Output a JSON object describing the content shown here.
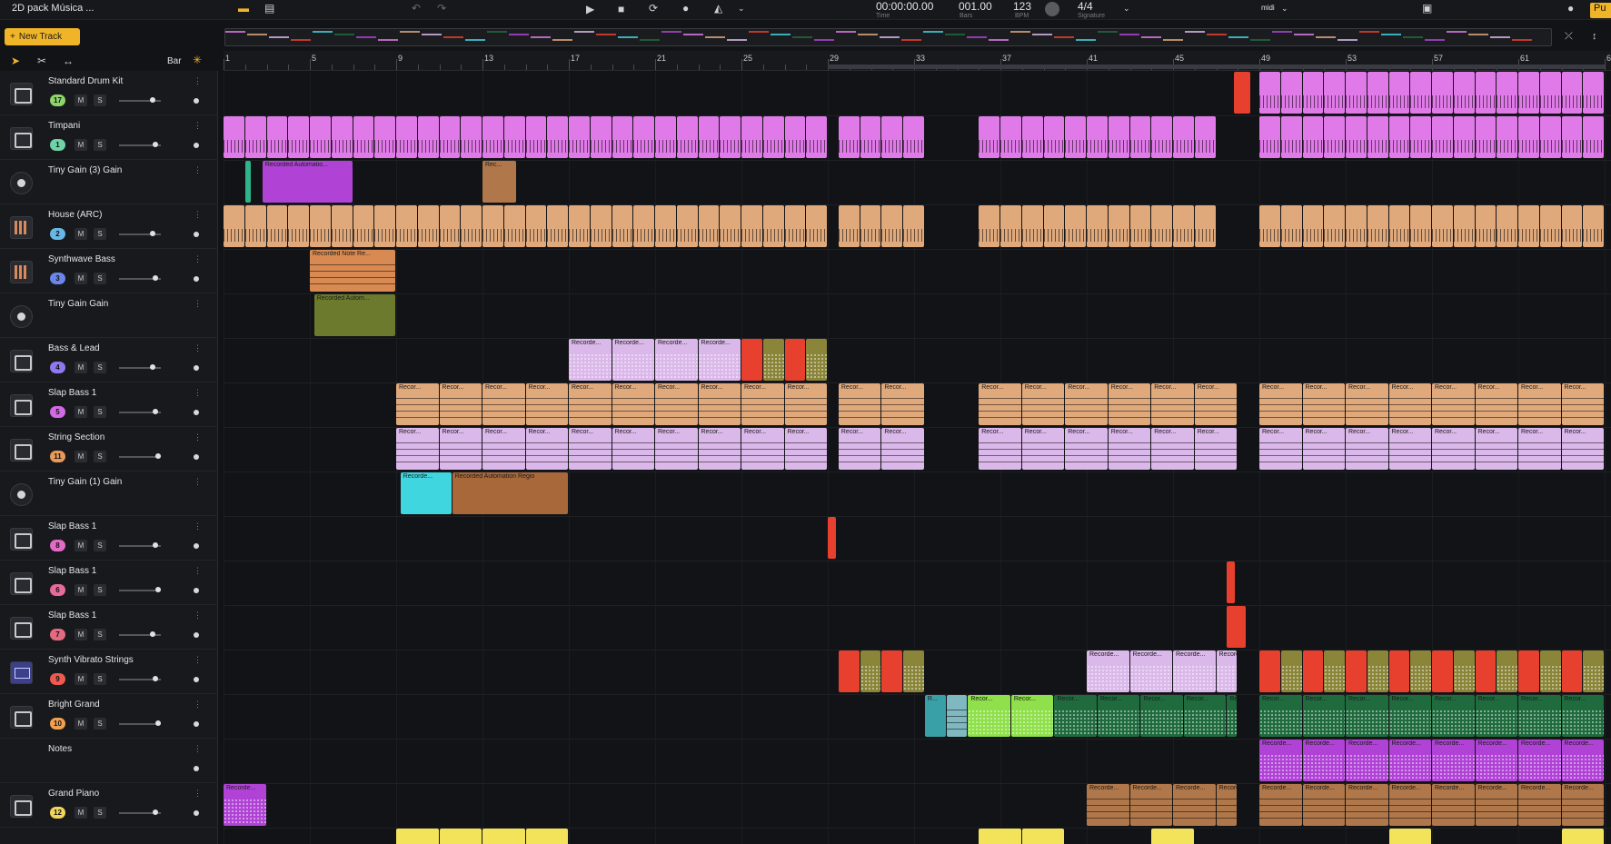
{
  "app": {
    "project_title": "2D pack Música ...",
    "transport": {
      "time": "00:00:00.00",
      "time_label": "Time",
      "bars": "001.00",
      "bars_label": "Bars",
      "bpm": "123",
      "bpm_label": "BPM",
      "signature": "4/4",
      "signature_label": "Signature",
      "midi_label": "midi",
      "right_text": "Pu"
    }
  },
  "toolbar": {
    "new_track_label": "New Track",
    "snap_label": "Bar"
  },
  "ruler": {
    "labels": [
      "1",
      "5",
      "9",
      "13",
      "17",
      "21",
      "25",
      "29",
      "33",
      "37",
      "41",
      "45",
      "49",
      "53",
      "57",
      "61",
      "6"
    ]
  },
  "tracks": [
    {
      "name": "Standard Drum Kit",
      "number": "17",
      "badge_color": "#8fd46b",
      "icon": "keys",
      "controls": true
    },
    {
      "name": "Timpani",
      "number": "1",
      "badge_color": "#6fd3a8",
      "icon": "keys",
      "controls": true
    },
    {
      "name": "Tiny Gain (3) Gain",
      "number": "",
      "badge_color": "",
      "icon": "knob",
      "controls": false
    },
    {
      "name": "House (ARC)",
      "number": "2",
      "badge_color": "#68b8e6",
      "icon": "grid",
      "controls": true
    },
    {
      "name": "Synthwave Bass",
      "number": "3",
      "badge_color": "#6a86ec",
      "icon": "grid",
      "controls": true
    },
    {
      "name": "Tiny Gain Gain",
      "number": "",
      "badge_color": "",
      "icon": "knob",
      "controls": false
    },
    {
      "name": "Bass & Lead",
      "number": "4",
      "badge_color": "#8f78ee",
      "icon": "keys",
      "controls": true
    },
    {
      "name": "Slap Bass 1",
      "number": "5",
      "badge_color": "#d06be3",
      "icon": "keys",
      "controls": true
    },
    {
      "name": "String Section",
      "number": "11",
      "badge_color": "#e89a5a",
      "icon": "keys",
      "controls": true
    },
    {
      "name": "Tiny Gain (1) Gain",
      "number": "",
      "badge_color": "",
      "icon": "knob",
      "controls": false
    },
    {
      "name": "Slap Bass 1",
      "number": "8",
      "badge_color": "#e36bc7",
      "icon": "keys",
      "controls": true
    },
    {
      "name": "Slap Bass 1",
      "number": "6",
      "badge_color": "#e66b9c",
      "icon": "keys",
      "controls": true
    },
    {
      "name": "Slap Bass 1",
      "number": "7",
      "badge_color": "#e46b7f",
      "icon": "keys",
      "controls": true
    },
    {
      "name": "Synth Vibrato Strings",
      "number": "9",
      "badge_color": "#ef5a50",
      "icon": "synth",
      "controls": true
    },
    {
      "name": "Bright Grand",
      "number": "10",
      "badge_color": "#f0a050",
      "icon": "keys",
      "controls": true
    },
    {
      "name": "Notes",
      "number": "",
      "badge_color": "",
      "icon": "none",
      "controls": false
    },
    {
      "name": "Grand Piano",
      "number": "12",
      "badge_color": "#f2d65a",
      "icon": "keys",
      "controls": true
    }
  ],
  "clips_text": {
    "tiny3_a": "Recorded Automatio...",
    "tiny3_b": "Rec...",
    "synthwave": "Recorded Note Re...",
    "tinygain": "Recorded Autom...",
    "recorde": "Recorde...",
    "recor": "Recor...",
    "tiny1_a": "Recorde...",
    "tiny1_b": "Recorded Automation Regio",
    "r": "R...",
    "recorde_short": "Recorde..."
  },
  "colors": {
    "accent": "#f0b429",
    "pink": "#e07ae8",
    "tan": "#e0a97c",
    "lavender": "#dbb8ea",
    "red": "#e8402e",
    "olive": "#8a8538",
    "green": "#8fe04a",
    "darkgreen": "#1f6b3e",
    "purple": "#b043d6",
    "brown": "#b0784a",
    "cyan": "#3fd6e0",
    "teal": "#3aa0a8"
  }
}
